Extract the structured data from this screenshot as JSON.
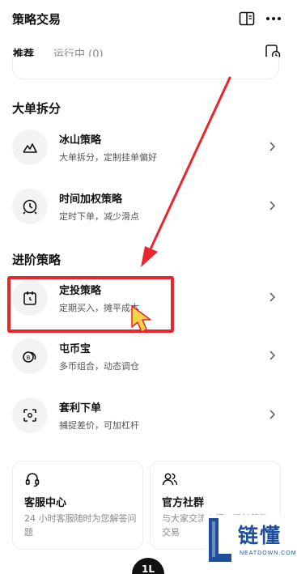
{
  "header": {
    "title": "策略交易",
    "book_icon": "book-icon",
    "more_icon": "more-icon"
  },
  "tabs": [
    {
      "label": "推荐",
      "active": true
    },
    {
      "label": "运行中 (0)",
      "active": false
    }
  ],
  "sections": [
    {
      "title": "大单拆分",
      "items": [
        {
          "title": "冰山策略",
          "subtitle": "大单拆分，定制挂单偏好",
          "icon": "mountain-icon"
        },
        {
          "title": "时间加权策略",
          "subtitle": "定时下单，减少滑点",
          "icon": "clock-icon"
        }
      ]
    },
    {
      "title": "进阶策略",
      "items": [
        {
          "title": "定投策略",
          "subtitle": "定期买入，摊平成本",
          "icon": "calendar-icon"
        },
        {
          "title": "屯币宝",
          "subtitle": "多币组合，动态调仓",
          "icon": "coin-icon"
        },
        {
          "title": "套利下单",
          "subtitle": "捕捉差价，可加杠杆",
          "icon": "arbitrage-icon"
        }
      ]
    }
  ],
  "cards": [
    {
      "title": "客服中心",
      "description": "24 小时客服随时为您解答问题",
      "icon": "headset-icon"
    },
    {
      "title": "官方社群",
      "description": "与大家交流心得，玩转策略交易",
      "icon": "people-icon"
    }
  ],
  "fab": {
    "label": "1L"
  },
  "watermark": {
    "text": "链懂",
    "sub": "NEATDOWN.COM"
  },
  "colors": {
    "highlight": "#e8262b",
    "accent": "#111111",
    "watermark": "#1e4f9c"
  }
}
